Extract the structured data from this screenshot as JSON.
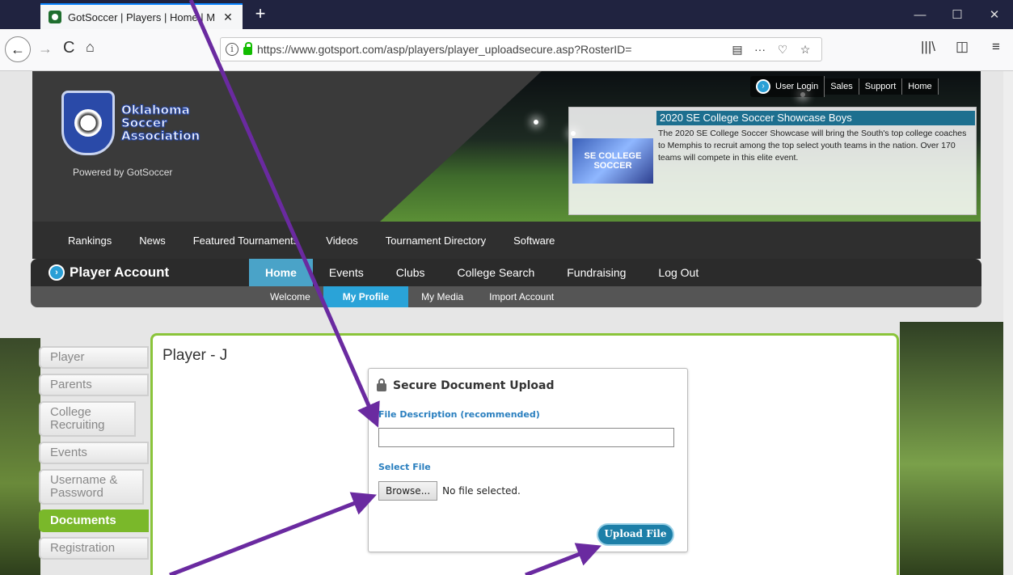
{
  "browser": {
    "tab_title": "GotSoccer | Players | Home | M",
    "tab_close": "✕",
    "new_tab": "+",
    "url": "https://www.gotsport.com/asp/players/player_uploadsecure.asp?RosterID=",
    "window_minimize": "—",
    "window_maximize": "☐",
    "window_close": "✕",
    "back": "←",
    "forward": "→",
    "reload": "C",
    "home": "⌂",
    "reader": "▤",
    "more": "···",
    "pocket": "♡",
    "bookmark": "☆",
    "library": "|||\\",
    "sidebar": "◫",
    "menu": "≡"
  },
  "header": {
    "logo_text": "Oklahoma Soccer Association",
    "powered_by": "Powered by GotSoccer",
    "top_links": [
      "User Login",
      "Sales",
      "Support",
      "Home"
    ],
    "login_arrow": "›",
    "promo": {
      "image_text": "SE COLLEGE SOCCER",
      "title": "2020 SE College Soccer Showcase Boys",
      "body": "The 2020 SE College Soccer Showcase will bring the South's top college coaches to Memphis to recruit among the top select youth teams in the nation. Over 170 teams will compete in this elite event."
    }
  },
  "main_nav": [
    "Rankings",
    "News",
    "Featured Tournaments",
    "Videos",
    "Tournament Directory",
    "Software"
  ],
  "account": {
    "title": "Player Account",
    "title_arrow": "›",
    "tabs": [
      "Home",
      "Events",
      "Clubs",
      "College Search",
      "Fundraising",
      "Log Out"
    ],
    "sub_tabs": [
      "Welcome",
      "My Profile",
      "My Media",
      "Import Account"
    ]
  },
  "sidebar": {
    "items": [
      "Player",
      "Parents",
      "College Recruiting",
      "Events",
      "Username & Password",
      "Documents",
      "Registration"
    ]
  },
  "content": {
    "title": "Player - J",
    "upload": {
      "title": "Secure Document Upload",
      "description_label": "File Description (recommended)",
      "description_value": "",
      "select_label": "Select File",
      "browse_label": "Browse...",
      "no_file_text": "No file selected.",
      "upload_label": "Upload File"
    }
  },
  "colors": {
    "annotation_arrow": "#6a2aa0",
    "accent_green": "#7ab82a",
    "accent_blue": "#2aa3d8"
  }
}
